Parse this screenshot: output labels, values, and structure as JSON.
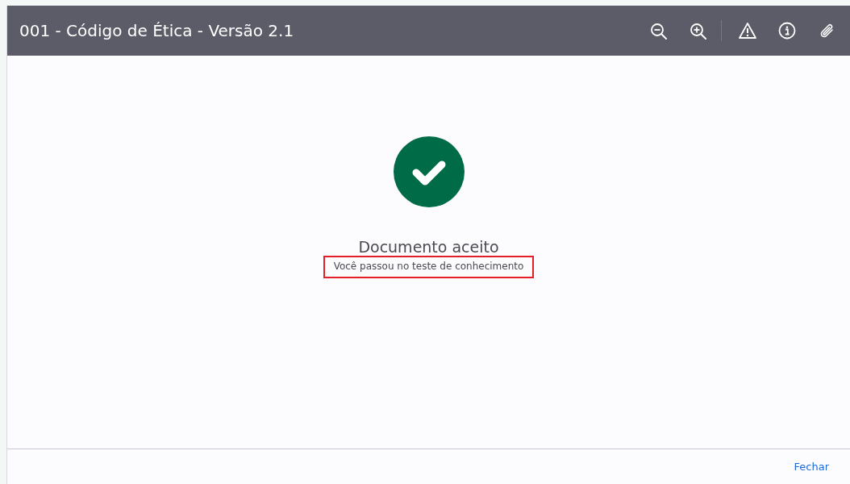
{
  "header": {
    "title": "001 - Código de Ética - Versão 2.1",
    "toolbar": [
      {
        "kind": "zoom-out"
      },
      {
        "kind": "zoom-in"
      },
      {
        "kind": "divider"
      },
      {
        "kind": "warning"
      },
      {
        "kind": "info"
      },
      {
        "kind": "attachment"
      }
    ]
  },
  "result": {
    "kind": "success",
    "title": "Documento aceito",
    "message": "Você passou no teste de conhecimento",
    "highlighted": true
  },
  "footer": {
    "buttons": [
      "Fechar"
    ]
  }
}
